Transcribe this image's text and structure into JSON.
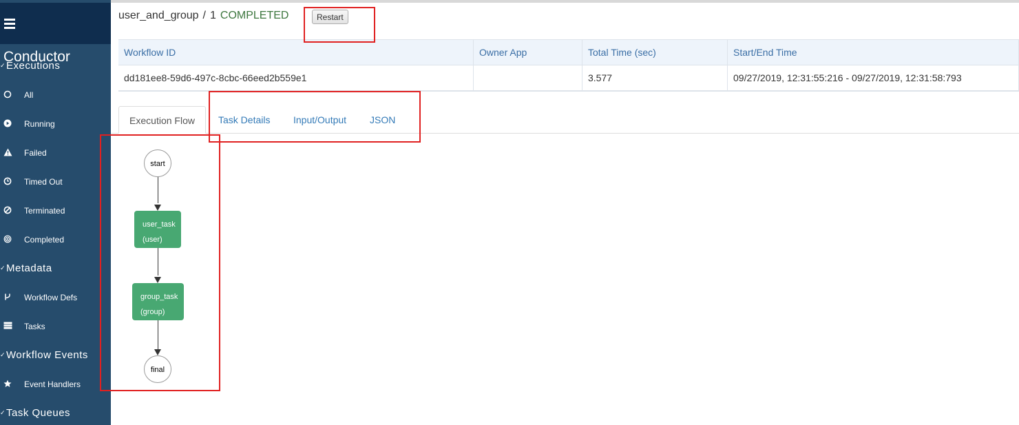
{
  "sidebar": {
    "brand": "Conductor",
    "sections": {
      "executions": "Executions",
      "metadata": "Metadata",
      "workflow_events": "Workflow Events",
      "task_queues": "Task Queues"
    },
    "items": [
      {
        "label": "All",
        "icon": "circle-outline-icon"
      },
      {
        "label": "Running",
        "icon": "play-circle-icon"
      },
      {
        "label": "Failed",
        "icon": "warning-icon"
      },
      {
        "label": "Timed Out",
        "icon": "clock-icon"
      },
      {
        "label": "Terminated",
        "icon": "ban-icon"
      },
      {
        "label": "Completed",
        "icon": "bullseye-icon"
      },
      {
        "label": "Workflow Defs",
        "icon": "code-fork-icon"
      },
      {
        "label": "Tasks",
        "icon": "tasks-icon"
      },
      {
        "label": "Event Handlers",
        "icon": "star-icon"
      }
    ]
  },
  "header": {
    "workflow_name": "user_and_group",
    "separator": "/",
    "version": "1",
    "status": "COMPLETED",
    "restart_label": "Restart"
  },
  "table": {
    "columns": [
      "Workflow ID",
      "Owner App",
      "Total Time (sec)",
      "Start/End Time"
    ],
    "row": [
      "dd181ee8-59d6-497c-8cbc-66eed2b559e1",
      "",
      "3.577",
      "09/27/2019, 12:31:55:216 - 09/27/2019, 12:31:58:793"
    ]
  },
  "tabs": [
    "Execution Flow",
    "Task Details",
    "Input/Output",
    "JSON"
  ],
  "diagram": {
    "start": "start",
    "tasks": [
      {
        "name": "user_task",
        "ref": "(user)"
      },
      {
        "name": "group_task",
        "ref": "(group)"
      }
    ],
    "end": "final"
  },
  "colors": {
    "sidebar_bg": "#264c6c",
    "sidebar_header_bg": "#0f2d4e",
    "status_completed": "#3c763d",
    "task_node": "#48a872",
    "annotation_box": "#e02020",
    "link": "#337ab7"
  }
}
